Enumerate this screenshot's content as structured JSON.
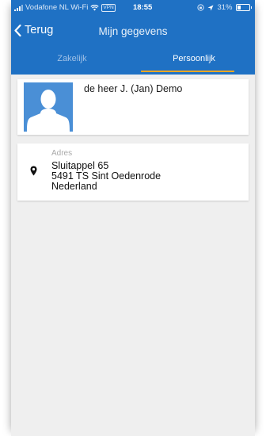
{
  "status_bar": {
    "carrier": "Vodafone NL Wi-Fi",
    "vpn": "VPN",
    "time": "18:55",
    "battery": "31%",
    "battery_level": 0.31
  },
  "nav": {
    "back_label": "Terug",
    "title": "Mijn gegevens"
  },
  "tabs": [
    {
      "label": "Zakelijk",
      "active": false
    },
    {
      "label": "Persoonlijk",
      "active": true
    }
  ],
  "profile": {
    "name": "de heer J. (Jan) Demo"
  },
  "address": {
    "label": "Adres",
    "lines": [
      "Sluitappel 65",
      "5491 TS Sint Oedenrode",
      "Nederland"
    ]
  },
  "colors": {
    "header": "#1f71c4",
    "tab_indicator": "#f6a622",
    "background": "#efefef",
    "avatar": "#4a8fd6"
  },
  "icons": [
    "signal-icon",
    "wifi-icon",
    "location-arrow-icon",
    "battery-icon",
    "back-chevron-icon",
    "avatar-silhouette-icon",
    "location-pin-icon"
  ]
}
